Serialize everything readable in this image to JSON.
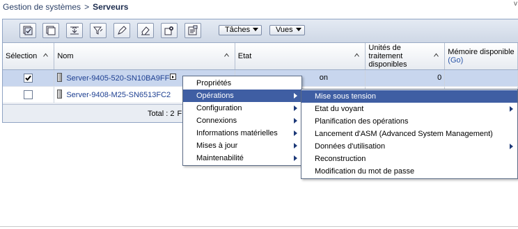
{
  "breadcrumb": {
    "parent": "Gestion de systèmes",
    "separator": ">",
    "current": "Serveurs"
  },
  "corner_mark": "v",
  "toolbar": {
    "icons": [
      "select-all-icon",
      "deselect-all-icon",
      "expand-icon",
      "filter-icon",
      "edit-icon",
      "clear-filter-icon",
      "configure-icon",
      "properties-icon"
    ],
    "tasks_label": "Tâches",
    "views_label": "Vues"
  },
  "table": {
    "columns": [
      {
        "label": "Sélection"
      },
      {
        "label": "Nom"
      },
      {
        "label": "Etat"
      },
      {
        "label": "Unités de traitement disponibles"
      },
      {
        "label": "Mémoire disponible",
        "suffix": "(Go)"
      }
    ],
    "rows": [
      {
        "selected": true,
        "name": "Server-9405-520-SN10BA9FF",
        "state": "on",
        "units": "0",
        "memory": ""
      },
      {
        "selected": false,
        "name": "Server-9408-M25-SN6513FC2",
        "state": "",
        "units": "",
        "memory": ""
      }
    ],
    "total": "Total : 2",
    "filtered_fragment": "F"
  },
  "context_menu": {
    "items": [
      {
        "label": "Propriétés",
        "submenu": false,
        "active": false
      },
      {
        "label": "Opérations",
        "submenu": true,
        "active": true
      },
      {
        "label": "Configuration",
        "submenu": true,
        "active": false
      },
      {
        "label": "Connexions",
        "submenu": true,
        "active": false
      },
      {
        "label": "Informations matérielles",
        "submenu": true,
        "active": false
      },
      {
        "label": "Mises à jour",
        "submenu": true,
        "active": false
      },
      {
        "label": "Maintenabilité",
        "submenu": true,
        "active": false
      }
    ]
  },
  "operations_menu": {
    "items": [
      {
        "label": "Mise sous tension",
        "submenu": false,
        "active": true
      },
      {
        "label": "Etat du voyant",
        "submenu": true,
        "active": false
      },
      {
        "label": "Planification des opérations",
        "submenu": false,
        "active": false
      },
      {
        "label": "Lancement d'ASM (Advanced System Management)",
        "submenu": false,
        "active": false
      },
      {
        "label": "Données d'utilisation",
        "submenu": true,
        "active": false
      },
      {
        "label": "Reconstruction",
        "submenu": false,
        "active": false
      },
      {
        "label": "Modification du mot de passe",
        "submenu": false,
        "active": false
      }
    ]
  },
  "colors": {
    "menu_highlight": "#3f5ea3",
    "selected_row": "#c8d6ee",
    "link": "#1d3f91"
  }
}
